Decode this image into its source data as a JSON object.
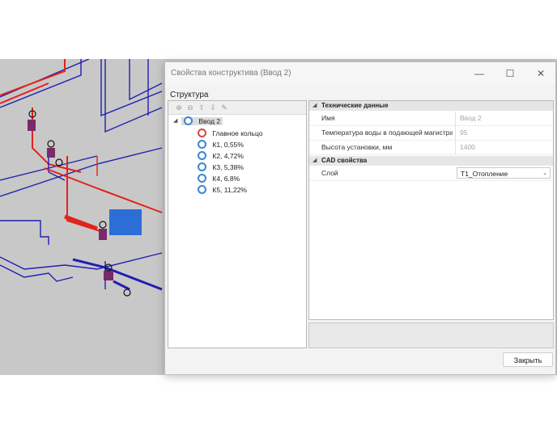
{
  "window": {
    "title": "Свойства конструктива (Ввод 2)",
    "minimize": "—",
    "maximize": "☐",
    "close": "✕"
  },
  "structure": {
    "label": "Структура",
    "toolbar_icons": [
      "add-icon",
      "remove-icon",
      "move-up-icon",
      "move-down-icon",
      "edit-icon"
    ],
    "root": {
      "label": "Ввод 2",
      "expander": "◢"
    },
    "items": [
      {
        "label": "Главное кольцо",
        "icon": "ring-main-icon",
        "color": "#d04a3a"
      },
      {
        "label": "К1, 0,55%",
        "icon": "ring-icon",
        "color": "#3a86d0"
      },
      {
        "label": "К2, 4,72%",
        "icon": "ring-icon",
        "color": "#3a86d0"
      },
      {
        "label": "К3, 5,38%",
        "icon": "ring-icon",
        "color": "#3a86d0"
      },
      {
        "label": "К4, 6,8%",
        "icon": "ring-icon",
        "color": "#3a86d0"
      },
      {
        "label": "К5, 11,22%",
        "icon": "ring-icon",
        "color": "#3a86d0"
      }
    ]
  },
  "properties": {
    "tech": {
      "title": "Технические данные",
      "rows": [
        {
          "name": "Имя",
          "value": "Ввод 2"
        },
        {
          "name": "Температура воды в подающей магистра...",
          "value": "95"
        },
        {
          "name": "Высота установки, мм",
          "value": "1400"
        }
      ]
    },
    "cad": {
      "title": "CAD свойства",
      "layer_name": "Слой",
      "layer_value": "Т1_Отопление"
    }
  },
  "footer": {
    "close_button": "Закрыть"
  },
  "colors": {
    "pipe_red": "#e0241b",
    "pipe_blue": "#1f1fb0",
    "radiator": "#2b6fd6",
    "background_cad": "#c8c8c8"
  }
}
